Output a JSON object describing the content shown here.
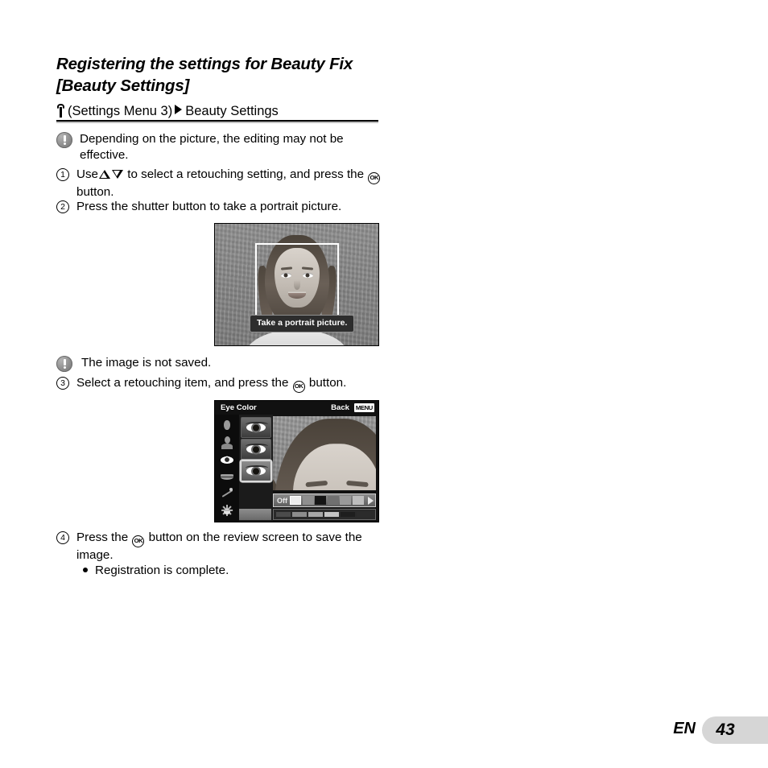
{
  "section": {
    "title": "Registering the settings for Beauty Fix [Beauty Settings]",
    "breadcrumb": {
      "menu_icon": "wrench-icon",
      "menu_label": "(Settings Menu 3)",
      "separator_icon": "triangle-right-icon",
      "target_label": "Beauty Settings"
    }
  },
  "notes": {
    "note1": "Depending on the picture, the editing may not be effective.",
    "note2": "The image is not saved."
  },
  "steps": {
    "step1": {
      "number": "1",
      "text_a": "Use",
      "text_b": "to select a retouching setting, and press the",
      "text_c": "button.",
      "ok_glyph": "OK"
    },
    "step2": {
      "number": "2",
      "text": "Press the shutter button to take a portrait picture."
    },
    "step3": {
      "number": "3",
      "text_a": "Select a retouching item, and press the",
      "text_b": "button.",
      "ok_glyph": "OK"
    },
    "step4": {
      "number": "4",
      "text_a": "Press the",
      "text_b": "button on the review screen to save the image.",
      "ok_glyph": "OK"
    },
    "bullet1": "Registration is complete."
  },
  "screenshot_portrait": {
    "caption": "Take a portrait picture.",
    "af_frame": "face-detection-frame"
  },
  "screenshot_eyecolor": {
    "title": "Eye Color",
    "back_label": "Back",
    "menu_badge": "MENU",
    "sidebar_icons": [
      "face-icon",
      "face-body-icon",
      "eye-icon",
      "lips-icon",
      "wand-icon",
      "sparkle-icon"
    ],
    "selected_sidebar_index": 2,
    "thumbnails": [
      "eye-option-1",
      "eye-option-2",
      "eye-option-3"
    ],
    "selected_thumbnail_index": 2,
    "slider": {
      "label": "Off",
      "swatches": [
        "#ededed",
        "#8f8f8f",
        "#141414",
        "#707070",
        "#9a9a9a",
        "#bdbdbd"
      ],
      "selected_swatch_index": 0,
      "arrow_icon": "triangle-right-icon"
    },
    "bottom_swatches": [
      "#4b4b4b",
      "#8d8d8d",
      "#a8a8a8",
      "#c6c6c6",
      "#1e1e1e",
      "#2b2b2b"
    ]
  },
  "footer": {
    "language": "EN",
    "page_number": "43"
  }
}
